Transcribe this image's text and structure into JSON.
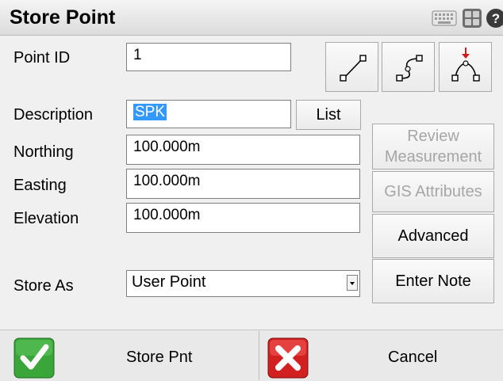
{
  "window": {
    "title": "Store Point"
  },
  "titlebar_icons": [
    "keyboard-icon",
    "calculator-icon",
    "help-icon"
  ],
  "form": {
    "point_id": {
      "label": "Point ID",
      "value": "1"
    },
    "description": {
      "label": "Description",
      "value": "SPK",
      "list_button": "List"
    },
    "northing": {
      "label": "Northing",
      "value": "100.000m"
    },
    "easting": {
      "label": "Easting",
      "value": "100.000m"
    },
    "elevation": {
      "label": "Elevation",
      "value": "100.000m"
    },
    "store_as": {
      "label": "Store As",
      "value": "User Point"
    }
  },
  "side_buttons": {
    "review": "Review Measurement",
    "gis": "GIS Attributes",
    "advanced": "Advanced",
    "enter_note": "Enter Note"
  },
  "geometry_buttons": [
    "line-icon",
    "polyline-icon",
    "arc-icon"
  ],
  "footer": {
    "store": "Store Pnt",
    "cancel": "Cancel"
  },
  "colors": {
    "selection": "#3399ff",
    "check": "#2e9e2e",
    "cancel": "#cc1f1f"
  }
}
